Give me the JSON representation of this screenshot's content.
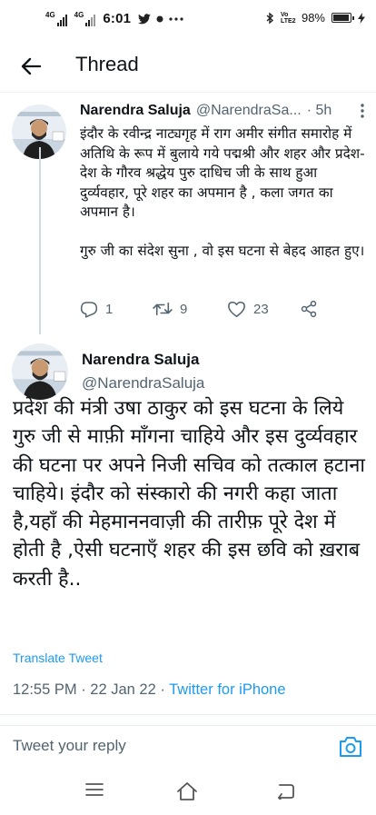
{
  "status_bar": {
    "net1_label": "4G",
    "net2_label": "4G",
    "time": "6:01",
    "volte_label": "Vo LTE2",
    "battery_text": "98%",
    "battery_level": 0.98,
    "icons": [
      "twitter-icon",
      "notification-dot-icon",
      "more-dots-icon",
      "bluetooth-icon",
      "battery-icon",
      "charging-icon"
    ]
  },
  "header": {
    "title": "Thread",
    "back_icon": "back-arrow-icon"
  },
  "tweets": [
    {
      "name": "Narendra Saluja",
      "handle": "@NarendraSa...",
      "time": "· 5h",
      "paragraphs": [
        "इंदौर के रवीन्द्र नाट्यगृह में राग अमीर संगीत समारोह में अतिथि के रूप में बुलाये गये पद्मश्री और शहर और प्रदेश-देश के गौरव श्रद्धेय पुरु दाधिच जी के साथ हुआ दुर्व्यवहार, पूरे शहर का अपमान है , कला जगत का अपमान है।",
        "गुरु जी का संदेश सुना , वो इस घटना से बेहद आहत हुए।"
      ],
      "actions": {
        "reply_count": "1",
        "retweet_count": "9",
        "like_count": "23"
      }
    },
    {
      "name": "Narendra Saluja",
      "handle": "@NarendraSaluja",
      "body": "प्रदेश की मंत्री उषा ठाकुर को इस घटना के लिये गुरु जी से माफ़ी माँगना चाहिये और इस दुर्व्यवहार की घटना पर अपने निजी सचिव को तत्काल हटाना चाहिये। इंदौर को संस्कारो की नगरी कहा जाता है,यहाँ की मेहमाननवाज़ी की तारीफ़ पूरे देश में होती है ,ऐसी घटनाएँ शहर की इस छवि को ख़राब करती है..",
      "translate_label": "Translate Tweet",
      "timestamp": "12:55 PM · 22 Jan 22 · ",
      "client": "Twitter for iPhone"
    }
  ],
  "reply_bar": {
    "placeholder": "Tweet your reply"
  },
  "colors": {
    "accent": "#1d9bf0",
    "secondary_text": "#536471",
    "primary_text": "#0f1419"
  }
}
